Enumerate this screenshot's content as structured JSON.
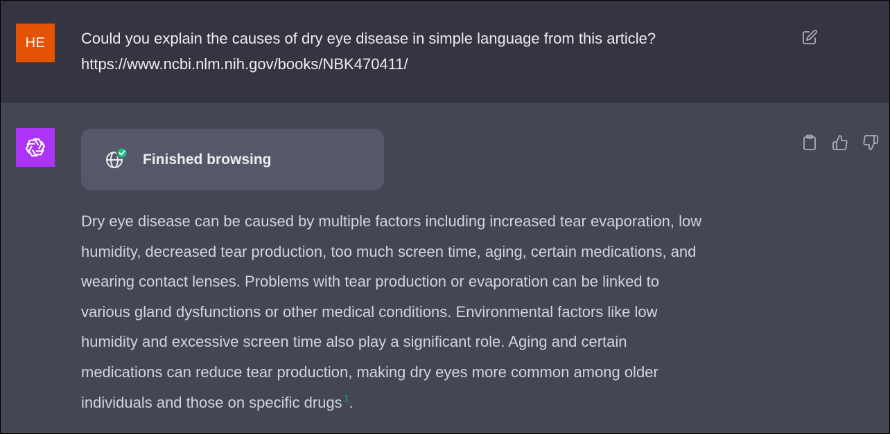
{
  "user_message": {
    "avatar_initials": "HE",
    "avatar_color": "#e35205",
    "lines": [
      "Could you explain the causes of dry eye disease in simple language from this article?",
      "https://www.ncbi.nlm.nih.gov/books/NBK470411/"
    ],
    "edit_icon": "edit-icon"
  },
  "assistant_message": {
    "avatar_icon": "openai-logo-icon",
    "avatar_color": "#ab34f5",
    "browsing": {
      "icon": "globe-check-icon",
      "label": "Finished browsing"
    },
    "answer_lines": [
      "Dry eye disease can be caused by multiple factors including increased tear evaporation, low",
      "humidity, decreased tear production, too much screen time, aging, certain medications, and",
      "wearing contact lenses. Problems with tear production or evaporation can be linked to",
      "various gland dysfunctions or other medical conditions. Environmental factors like low",
      "humidity and excessive screen time also play a significant role. Aging and certain",
      "medications can reduce tear production, making dry eyes more common among older",
      "individuals and those on specific drugs"
    ],
    "citation": "1",
    "final_punctuation": ".",
    "actions": [
      "copy-icon",
      "thumbs-up-icon",
      "thumbs-down-icon"
    ],
    "citation_color": "#10a37f"
  }
}
